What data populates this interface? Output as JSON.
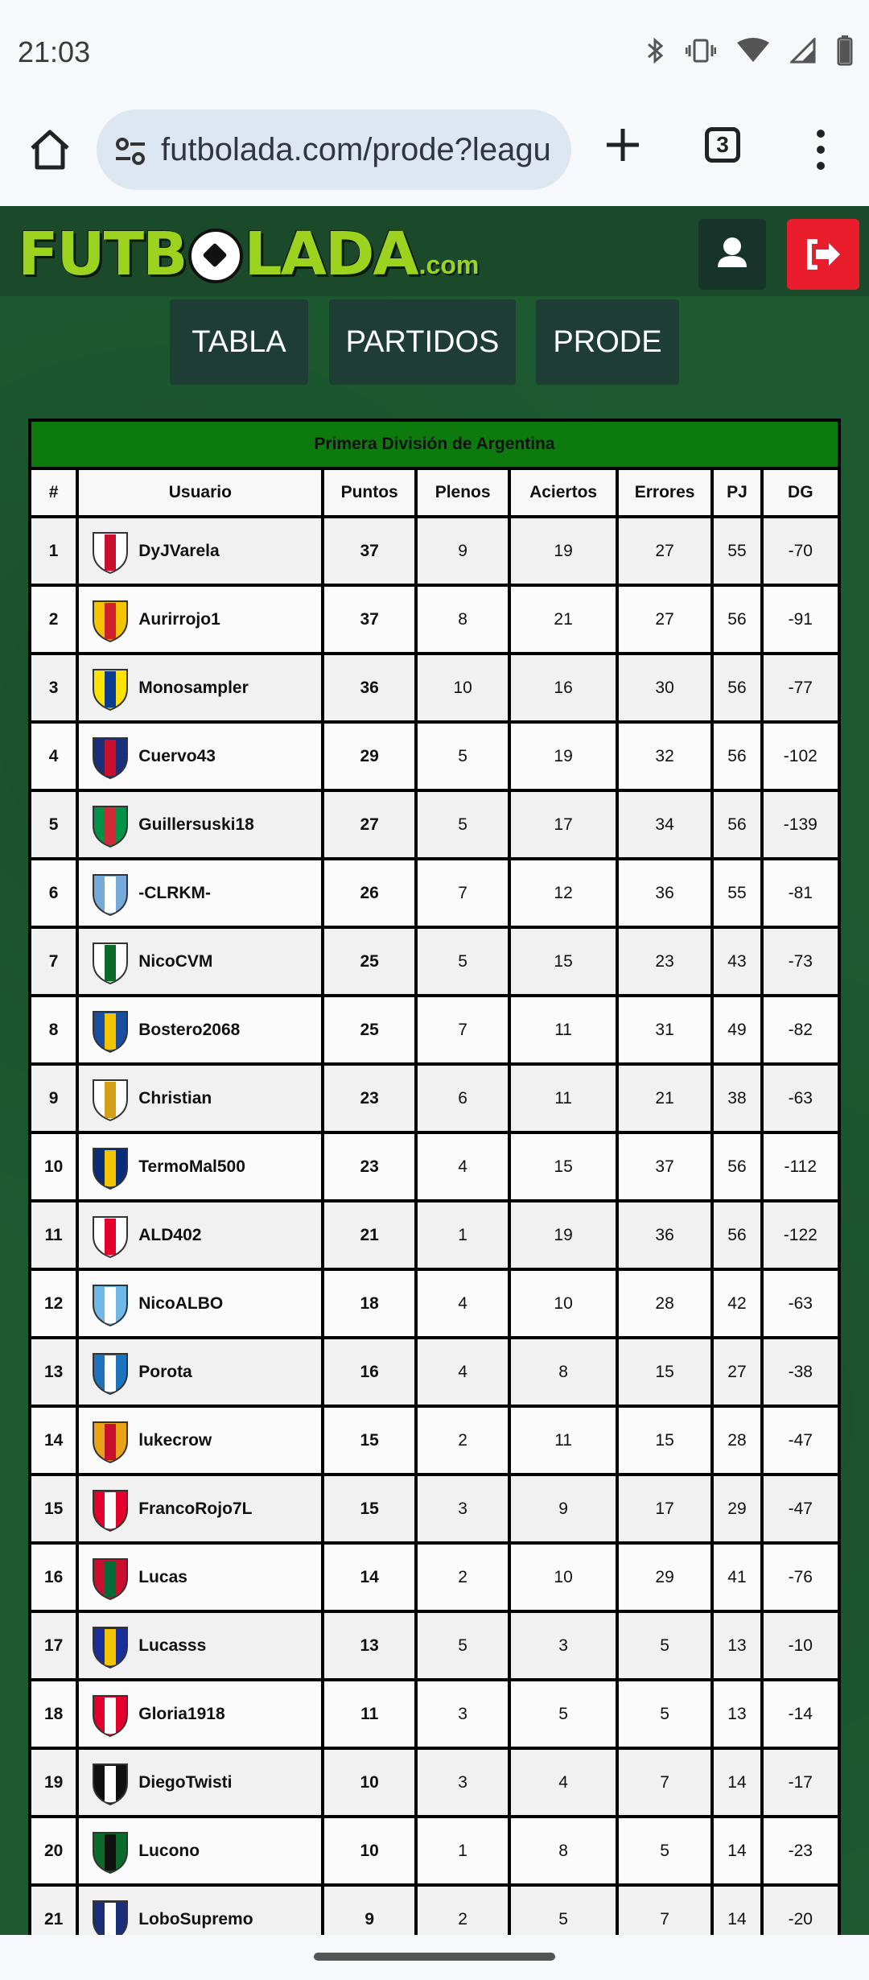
{
  "status": {
    "time": "21:03"
  },
  "browser": {
    "url": "futbolada.com/prode?leagu",
    "tab_count": "3"
  },
  "site": {
    "logo_text": "FUTB",
    "logo_text2": "LADA",
    "logo_suffix": ".com",
    "nav": [
      "TABLA",
      "PARTIDOS",
      "PRODE"
    ]
  },
  "table": {
    "league": "Primera División de Argentina",
    "headers": [
      "#",
      "Usuario",
      "Puntos",
      "Plenos",
      "Aciertos",
      "Errores",
      "PJ",
      "DG"
    ],
    "rows": [
      {
        "pos": "1",
        "user": "DyJVarela",
        "pts": "37",
        "plenos": "9",
        "aciertos": "19",
        "errores": "27",
        "pj": "55",
        "dg": "-70",
        "crest": "england-crest",
        "colors": [
          "#ffffff",
          "#c8102e"
        ]
      },
      {
        "pos": "2",
        "user": "Aurirrojo1",
        "pts": "37",
        "plenos": "8",
        "aciertos": "21",
        "errores": "27",
        "pj": "56",
        "dg": "-91",
        "crest": "barcelona-sc-crest",
        "colors": [
          "#f5c400",
          "#d0202a"
        ]
      },
      {
        "pos": "3",
        "user": "Monosampler",
        "pts": "36",
        "plenos": "10",
        "aciertos": "16",
        "errores": "30",
        "pj": "56",
        "dg": "-77",
        "crest": "villarreal-crest",
        "colors": [
          "#ffe300",
          "#0a3d91"
        ]
      },
      {
        "pos": "4",
        "user": "Cuervo43",
        "pts": "29",
        "plenos": "5",
        "aciertos": "19",
        "errores": "32",
        "pj": "56",
        "dg": "-102",
        "crest": "san-lorenzo-crest",
        "colors": [
          "#1a2f7a",
          "#c8102e"
        ]
      },
      {
        "pos": "5",
        "user": "Guillersuski18",
        "pts": "27",
        "plenos": "5",
        "aciertos": "17",
        "errores": "34",
        "pj": "56",
        "dg": "-139",
        "crest": "italia-crest",
        "colors": [
          "#009246",
          "#ce2b37"
        ]
      },
      {
        "pos": "6",
        "user": "-CLRKM-",
        "pts": "26",
        "plenos": "7",
        "aciertos": "12",
        "errores": "36",
        "pj": "55",
        "dg": "-81",
        "crest": "afa-crest",
        "colors": [
          "#75aadb",
          "#ffffff"
        ]
      },
      {
        "pos": "7",
        "user": "NicoCVM",
        "pts": "25",
        "plenos": "5",
        "aciertos": "15",
        "errores": "23",
        "pj": "43",
        "dg": "-73",
        "crest": "cvm-crest",
        "colors": [
          "#ffffff",
          "#0b6b2a"
        ]
      },
      {
        "pos": "8",
        "user": "Bostero2068",
        "pts": "25",
        "plenos": "7",
        "aciertos": "11",
        "errores": "31",
        "pj": "49",
        "dg": "-82",
        "crest": "cadiz-crest",
        "colors": [
          "#1a4fa0",
          "#f5c400"
        ]
      },
      {
        "pos": "9",
        "user": "Christian",
        "pts": "23",
        "plenos": "6",
        "aciertos": "11",
        "errores": "21",
        "pj": "38",
        "dg": "-63",
        "crest": "real-madrid-crest",
        "colors": [
          "#ffffff",
          "#d4a017"
        ]
      },
      {
        "pos": "10",
        "user": "TermoMal500",
        "pts": "23",
        "plenos": "4",
        "aciertos": "15",
        "errores": "37",
        "pj": "56",
        "dg": "-112",
        "crest": "boca-juniors-crest",
        "colors": [
          "#0a2d7a",
          "#f5c400"
        ]
      },
      {
        "pos": "11",
        "user": "ALD402",
        "pts": "21",
        "plenos": "1",
        "aciertos": "19",
        "errores": "36",
        "pj": "56",
        "dg": "-122",
        "crest": "river-plate-crest",
        "colors": [
          "#ffffff",
          "#e4002b"
        ]
      },
      {
        "pos": "12",
        "user": "NicoALBO",
        "pts": "18",
        "plenos": "4",
        "aciertos": "10",
        "errores": "28",
        "pj": "42",
        "dg": "-63",
        "crest": "gimnasia-tucuman-crest",
        "colors": [
          "#6fb9e8",
          "#ffffff"
        ]
      },
      {
        "pos": "13",
        "user": "Porota",
        "pts": "16",
        "plenos": "4",
        "aciertos": "8",
        "errores": "15",
        "pj": "27",
        "dg": "-38",
        "crest": "celaya-crest",
        "colors": [
          "#1e73be",
          "#ffffff"
        ]
      },
      {
        "pos": "14",
        "user": "lukecrow",
        "pts": "15",
        "plenos": "2",
        "aciertos": "11",
        "errores": "15",
        "pj": "28",
        "dg": "-47",
        "crest": "lucks-crest",
        "colors": [
          "#e8a317",
          "#c8102e"
        ]
      },
      {
        "pos": "15",
        "user": "FrancoRojo7L",
        "pts": "15",
        "plenos": "3",
        "aciertos": "9",
        "errores": "17",
        "pj": "29",
        "dg": "-47",
        "crest": "independiente-crest",
        "colors": [
          "#e4002b",
          "#ffffff"
        ]
      },
      {
        "pos": "16",
        "user": "Lucas",
        "pts": "14",
        "plenos": "2",
        "aciertos": "10",
        "errores": "29",
        "pj": "41",
        "dg": "-76",
        "crest": "portugal-crest",
        "colors": [
          "#c8102e",
          "#046a38"
        ]
      },
      {
        "pos": "17",
        "user": "Lucasss",
        "pts": "13",
        "plenos": "5",
        "aciertos": "3",
        "errores": "5",
        "pj": "13",
        "dg": "-10",
        "crest": "sol-de-america-crest",
        "colors": [
          "#1a2f9a",
          "#f5c400"
        ]
      },
      {
        "pos": "18",
        "user": "Gloria1918",
        "pts": "11",
        "plenos": "3",
        "aciertos": "5",
        "errores": "5",
        "pj": "13",
        "dg": "-14",
        "crest": "instituto-crest",
        "colors": [
          "#e4002b",
          "#ffffff"
        ]
      },
      {
        "pos": "19",
        "user": "DiegoTwisti",
        "pts": "10",
        "plenos": "3",
        "aciertos": "4",
        "errores": "7",
        "pj": "14",
        "dg": "-17",
        "crest": "chaco-for-ever-crest",
        "colors": [
          "#111111",
          "#ffffff"
        ]
      },
      {
        "pos": "20",
        "user": "Lucono",
        "pts": "10",
        "plenos": "1",
        "aciertos": "8",
        "errores": "5",
        "pj": "14",
        "dg": "-23",
        "crest": "nueva-chicago-crest",
        "colors": [
          "#0b6b2a",
          "#111111"
        ]
      },
      {
        "pos": "21",
        "user": "LoboSupremo",
        "pts": "9",
        "plenos": "2",
        "aciertos": "5",
        "errores": "7",
        "pj": "14",
        "dg": "-20",
        "crest": "gimnasia-lp-crest",
        "colors": [
          "#1a2f7a",
          "#ffffff"
        ]
      }
    ]
  }
}
